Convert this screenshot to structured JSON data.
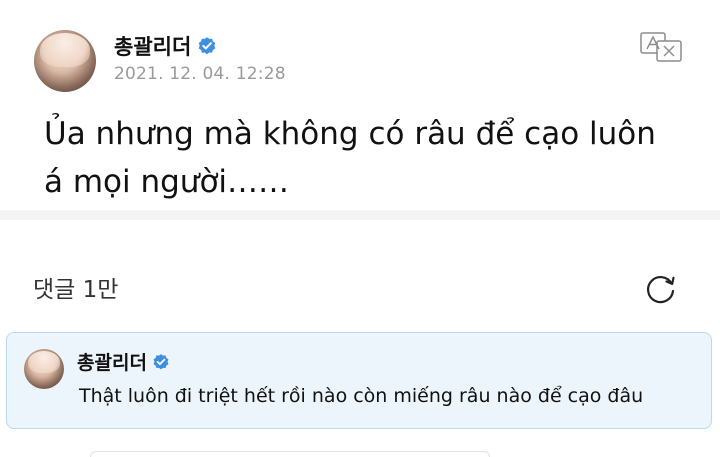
{
  "post": {
    "author": "총괄리더",
    "verified": true,
    "timestamp": "2021. 12. 04. 12:28",
    "text": "Ủa nhưng mà không có râu để cạo luôn á mọi người……",
    "translate_icon": "translate-icon"
  },
  "comments": {
    "title": "댓글 1만",
    "refresh_icon": "refresh-icon"
  },
  "pinned_comment": {
    "author": "총괄리더",
    "verified": true,
    "text": "Thật luôn đi triệt hết rồi nào còn miếng râu nào để cạo đâu"
  },
  "colors": {
    "verified_badge": "#3f8fe0",
    "comment_card_bg": "#ecf5fb",
    "comment_card_border": "#bcd9ee",
    "timestamp": "#9a9a9a"
  }
}
